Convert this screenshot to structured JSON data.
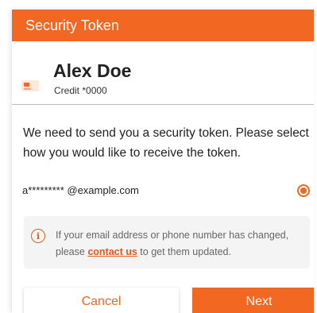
{
  "header": {
    "title": "Security Token"
  },
  "account": {
    "name": "Alex Doe",
    "subtitle": "Credit *0000",
    "icon": "credit-card-icon"
  },
  "instructions": "We need to send you a security token. Please select how you would like to receive the token.",
  "options": [
    {
      "label": "a********* @example.com",
      "selected": true
    }
  ],
  "notice": {
    "icon": "info-icon",
    "before": "If your email address or phone number has changed,  please ",
    "link": "contact us",
    "after": " to get them updated."
  },
  "buttons": {
    "cancel": "Cancel",
    "next": "Next"
  },
  "colors": {
    "accent": "#f26722",
    "notice_bg": "#f4f4f4"
  }
}
